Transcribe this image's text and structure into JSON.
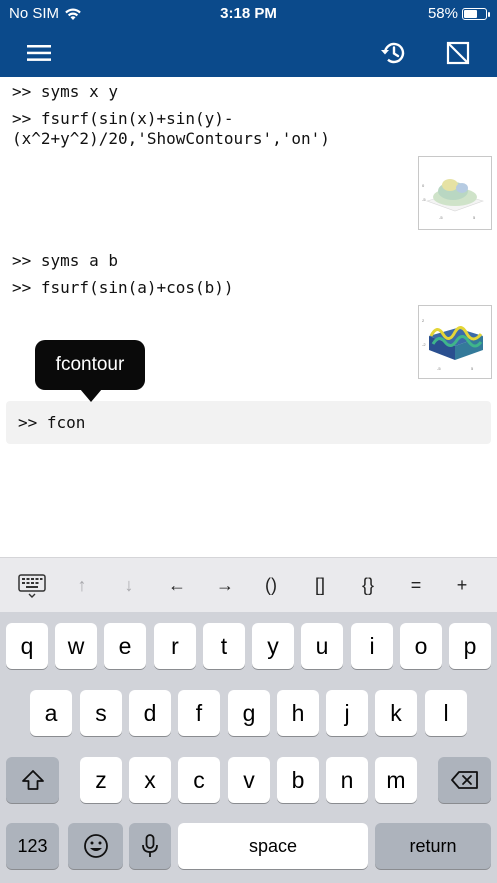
{
  "status_bar": {
    "carrier": "No SIM",
    "time": "3:18 PM",
    "battery": "58%",
    "battery_level": 0.58
  },
  "app_bar": {
    "icons": [
      "menu-icon",
      "history-icon",
      "plot-window-icon"
    ]
  },
  "command_window": {
    "lines": [
      ">> syms x y",
      ">> fsurf(sin(x)+sin(y)-",
      "(x^2+y^2)/20,'ShowContours','on')",
      ">> syms a b",
      ">> fsurf(sin(a)+cos(b))"
    ],
    "input_text": ">> fcon",
    "tooltip": "fcontour"
  },
  "accessory_bar": {
    "keys": [
      "↑",
      "↓",
      "←",
      "→",
      "()",
      "[]",
      "{}",
      "=",
      "+"
    ]
  },
  "keyboard": {
    "row1": [
      "q",
      "w",
      "e",
      "r",
      "t",
      "y",
      "u",
      "i",
      "o",
      "p"
    ],
    "row2": [
      "a",
      "s",
      "d",
      "f",
      "g",
      "h",
      "j",
      "k",
      "l"
    ],
    "row3": [
      "z",
      "x",
      "c",
      "v",
      "b",
      "n",
      "m"
    ],
    "numbers_label": "123",
    "space_label": "space",
    "return_label": "return"
  },
  "colors": {
    "header": "#0b4a8b",
    "keyboard_bg": "#d1d3d9",
    "dark_key": "#adb3bc"
  }
}
